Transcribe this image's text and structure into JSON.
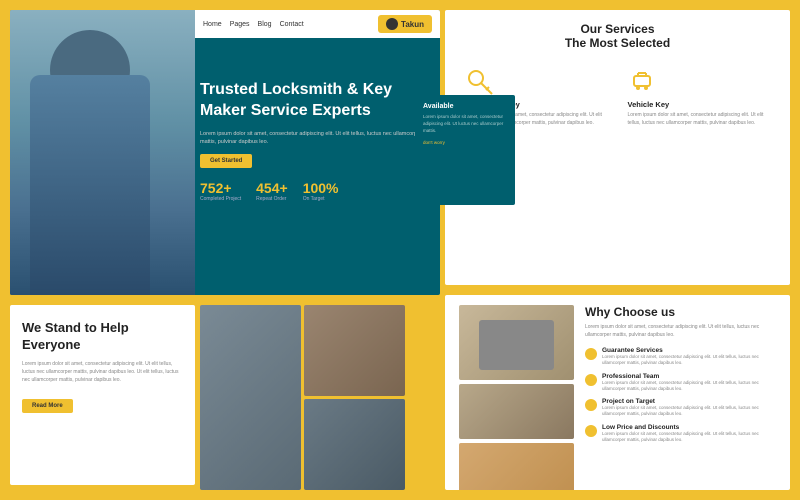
{
  "page": {
    "background_color": "#f0c030"
  },
  "nav": {
    "items": [
      "Home",
      "Pages",
      "Blog",
      "Contact"
    ],
    "logo": "Takun"
  },
  "hero": {
    "title": "Trusted Locksmith & Key Maker Service Experts",
    "description": "Lorem ipsum dolor sit amet, consectetur adipiscing elit. Ut elit tellus, luctus nec ullamcorper mattis, pulvinar dapibus leo.",
    "button_label": "Get Started",
    "stats": [
      {
        "number": "752+",
        "label": "Completed Project"
      },
      {
        "number": "454+",
        "label": "Repeat Order"
      },
      {
        "number": "100%",
        "label": "On Target"
      }
    ]
  },
  "stand": {
    "title": "We Stand to Help Everyone",
    "description": "Lorem ipsum dolor sit amet, consectetur adipiscing elit. Ut elit tellus, luctus nec ullamcorper mattis, pulvinar dapibus leo. Ut elit tellus, luctus nec ullamcorper mattis, pulvinar dapibus leo.",
    "button_label": "Read More"
  },
  "services": {
    "title": "Our Services",
    "subtitle": "The Most Selected",
    "items": [
      {
        "name": "Customize Key",
        "description": "Lorem ipsum dolor sit amet, consectetur adipiscing elit. Ut elit tellus, luctus nec ullamcorper mattis, pulvinar dapibus leo."
      },
      {
        "name": "Vehicle Key",
        "description": "Lorem ipsum dolor sit amet, consectetur adipiscing elit. Ut elit tellus, luctus nec ullamcorper mattis, pulvinar dapibus leo."
      }
    ]
  },
  "available": {
    "title": "Available",
    "description": "Lorem ipsum dolor sit amet, consectetur adipiscing elit. Ut luctus nec ullamcorper mattis.",
    "note": "don't worry"
  },
  "choose": {
    "title": "Why Choose us",
    "description": "Lorem ipsum dolor sit amet, consectetur adipiscing elit. Ut elit tellus, luctus nec ullamcorper mattis, pulvinar dapibus leo.",
    "items": [
      {
        "title": "Guarantee Services",
        "description": "Lorem ipsum dolor sit amet, consectetur adipiscing elit. Ut elit tellus, luctus nec ullamcorper mattis, pulvinar dapibus leo."
      },
      {
        "title": "Professional Team",
        "description": "Lorem ipsum dolor sit amet, consectetur adipiscing elit. Ut elit tellus, luctus nec ullamcorper mattis, pulvinar dapibus leo."
      },
      {
        "title": "Project on Target",
        "description": "Lorem ipsum dolor sit amet, consectetur adipiscing elit. Ut elit tellus, luctus nec ullamcorper mattis, pulvinar dapibus leo."
      },
      {
        "title": "Low Price and Discounts",
        "description": "Lorem ipsum dolor sit amet, consectetur adipiscing elit. Ut elit tellus, luctus nec ullamcorper mattis, pulvinar dapibus leo."
      }
    ]
  }
}
